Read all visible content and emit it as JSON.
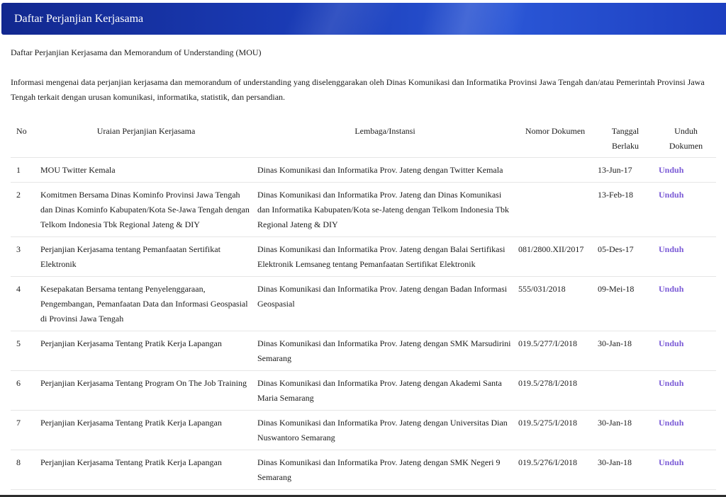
{
  "header": {
    "title": "Daftar Perjanjian Kerjasama"
  },
  "subtitle": "Daftar Perjanjian Kerjasama dan Memorandum of Understanding (MOU)",
  "intro": "Informasi mengenai data perjanjian kerjasama dan memorandum of understanding yang diselenggarakan oleh Dinas Komunikasi dan Informatika Provinsi Jawa Tengah dan/atau Pemerintah Provinsi Jawa Tengah terkait dengan urusan komunikasi, informatika, statistik, dan persandian.",
  "table": {
    "columns": {
      "no": "No",
      "uraian": "Uraian Perjanjian Kerjasama",
      "lembaga": "Lembaga/Instansi",
      "nomor": "Nomor Dokumen",
      "tanggal": "Tanggal Berlaku",
      "unduh": "Unduh Dokumen"
    },
    "download_label": "Unduh",
    "rows": [
      {
        "no": "1",
        "uraian": "MOU Twitter Kemala",
        "lembaga": "Dinas Komunikasi dan Informatika Prov. Jateng dengan Twitter Kemala",
        "nomor": "",
        "tanggal": "13-Jun-17"
      },
      {
        "no": "2",
        "uraian": "Komitmen Bersama Dinas Kominfo Provinsi Jawa Tengah dan Dinas Kominfo Kabupaten/Kota Se-Jawa Tengah dengan Telkom Indonesia Tbk Regional Jateng & DIY",
        "lembaga": "Dinas Komunikasi dan Informatika Prov. Jateng dan Dinas Komunikasi dan Informatika Kabupaten/Kota se-Jateng dengan Telkom Indonesia Tbk Regional Jateng & DIY",
        "nomor": "",
        "tanggal": "13-Feb-18"
      },
      {
        "no": "3",
        "uraian": "Perjanjian Kerjasama tentang Pemanfaatan Sertifikat Elektronik",
        "lembaga": "Dinas Komunikasi dan Informatika Prov. Jateng dengan Balai Sertifikasi Elektronik Lemsaneg tentang Pemanfaatan Sertifikat Elektronik",
        "nomor": "081/2800.XII/2017",
        "tanggal": "05-Des-17"
      },
      {
        "no": "4",
        "uraian": "Kesepakatan Bersama tentang Penyelenggaraan, Pengembangan, Pemanfaatan Data dan Informasi Geospasial di Provinsi Jawa Tengah",
        "lembaga": "Dinas Komunikasi dan Informatika Prov. Jateng dengan Badan Informasi Geospasial",
        "nomor": "555/031/2018",
        "tanggal": "09-Mei-18"
      },
      {
        "no": "5",
        "uraian": "Perjanjian Kerjasama Tentang Pratik Kerja Lapangan",
        "lembaga": "Dinas Komunikasi dan Informatika Prov. Jateng dengan SMK Marsudirini Semarang",
        "nomor": "019.5/277/I/2018",
        "tanggal": "30-Jan-18"
      },
      {
        "no": "6",
        "uraian": "Perjanjian Kerjasama Tentang Program On The Job Training",
        "lembaga": "Dinas Komunikasi dan Informatika Prov. Jateng dengan Akademi Santa Maria Semarang",
        "nomor": "019.5/278/I/2018",
        "tanggal": ""
      },
      {
        "no": "7",
        "uraian": "Perjanjian Kerjasama Tentang Pratik Kerja Lapangan",
        "lembaga": "Dinas Komunikasi dan Informatika Prov. Jateng dengan Universitas Dian Nuswantoro Semarang",
        "nomor": "019.5/275/I/2018",
        "tanggal": "30-Jan-18"
      },
      {
        "no": "8",
        "uraian": "Perjanjian Kerjasama Tentang Pratik Kerja Lapangan",
        "lembaga": "Dinas Komunikasi dan Informatika Prov. Jateng dengan SMK Negeri 9 Semarang",
        "nomor": "019.5/276/I/2018",
        "tanggal": "30-Jan-18"
      }
    ]
  }
}
